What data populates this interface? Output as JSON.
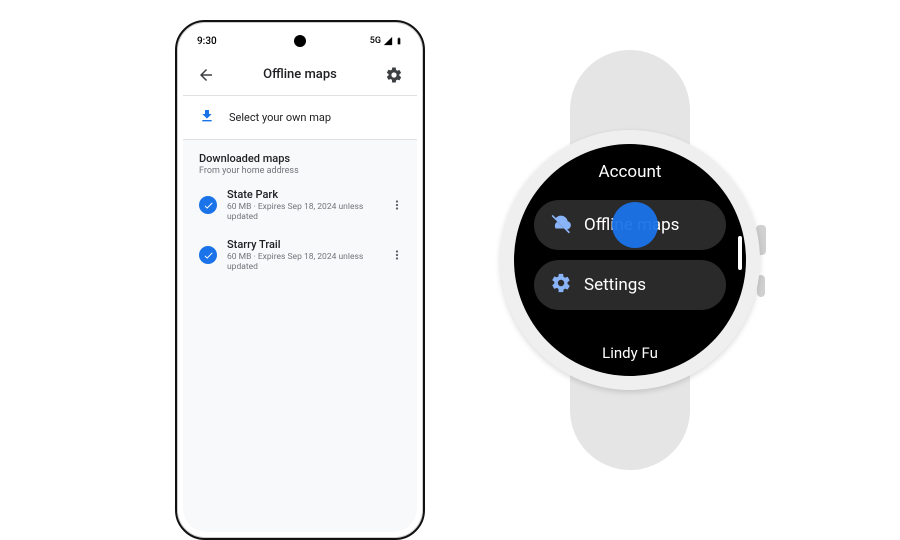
{
  "phone": {
    "status": {
      "time": "9:30",
      "network": "5G"
    },
    "appbar": {
      "title": "Offline maps"
    },
    "select_row": {
      "label": "Select your own map"
    },
    "section": {
      "title": "Downloaded maps",
      "subtitle": "From your home address"
    },
    "maps": [
      {
        "name": "State Park",
        "meta": "60 MB · Expires Sep 18, 2024 unless updated"
      },
      {
        "name": "Starry Trail",
        "meta": "60 MB · Expires Sep 18, 2024 unless updated"
      }
    ]
  },
  "watch": {
    "header": "Account",
    "items": [
      {
        "icon": "cloud-off-icon",
        "label": "Offline maps"
      },
      {
        "icon": "gear-icon",
        "label": "Settings"
      }
    ],
    "footer": "Lindy Fu"
  }
}
